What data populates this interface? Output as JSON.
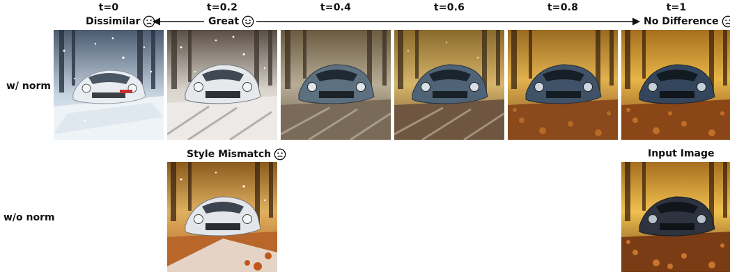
{
  "timesteps": [
    "t=0",
    "t=0.2",
    "t=0.4",
    "t=0.6",
    "t=0.8",
    "t=1"
  ],
  "annotations": {
    "left": "Dissimilar",
    "middle": "Great",
    "right": "No Difference"
  },
  "row_labels": {
    "with_norm": "w/ norm",
    "without_norm": "w/o norm"
  },
  "captions": {
    "style_mismatch": "Style Mismatch",
    "input_image": "Input Image"
  },
  "faces": {
    "left": "sad-face-icon",
    "middle": "happy-face-icon",
    "right": "sad-face-icon",
    "style_mismatch": "sad-face-icon"
  },
  "colors": {
    "snow_sky": "#e8eef5",
    "autumn_sky": "#e0a23a",
    "leaves": "#9a4a1a",
    "car_white": "#e6e9ee",
    "car_dark": "#2f3a48"
  }
}
